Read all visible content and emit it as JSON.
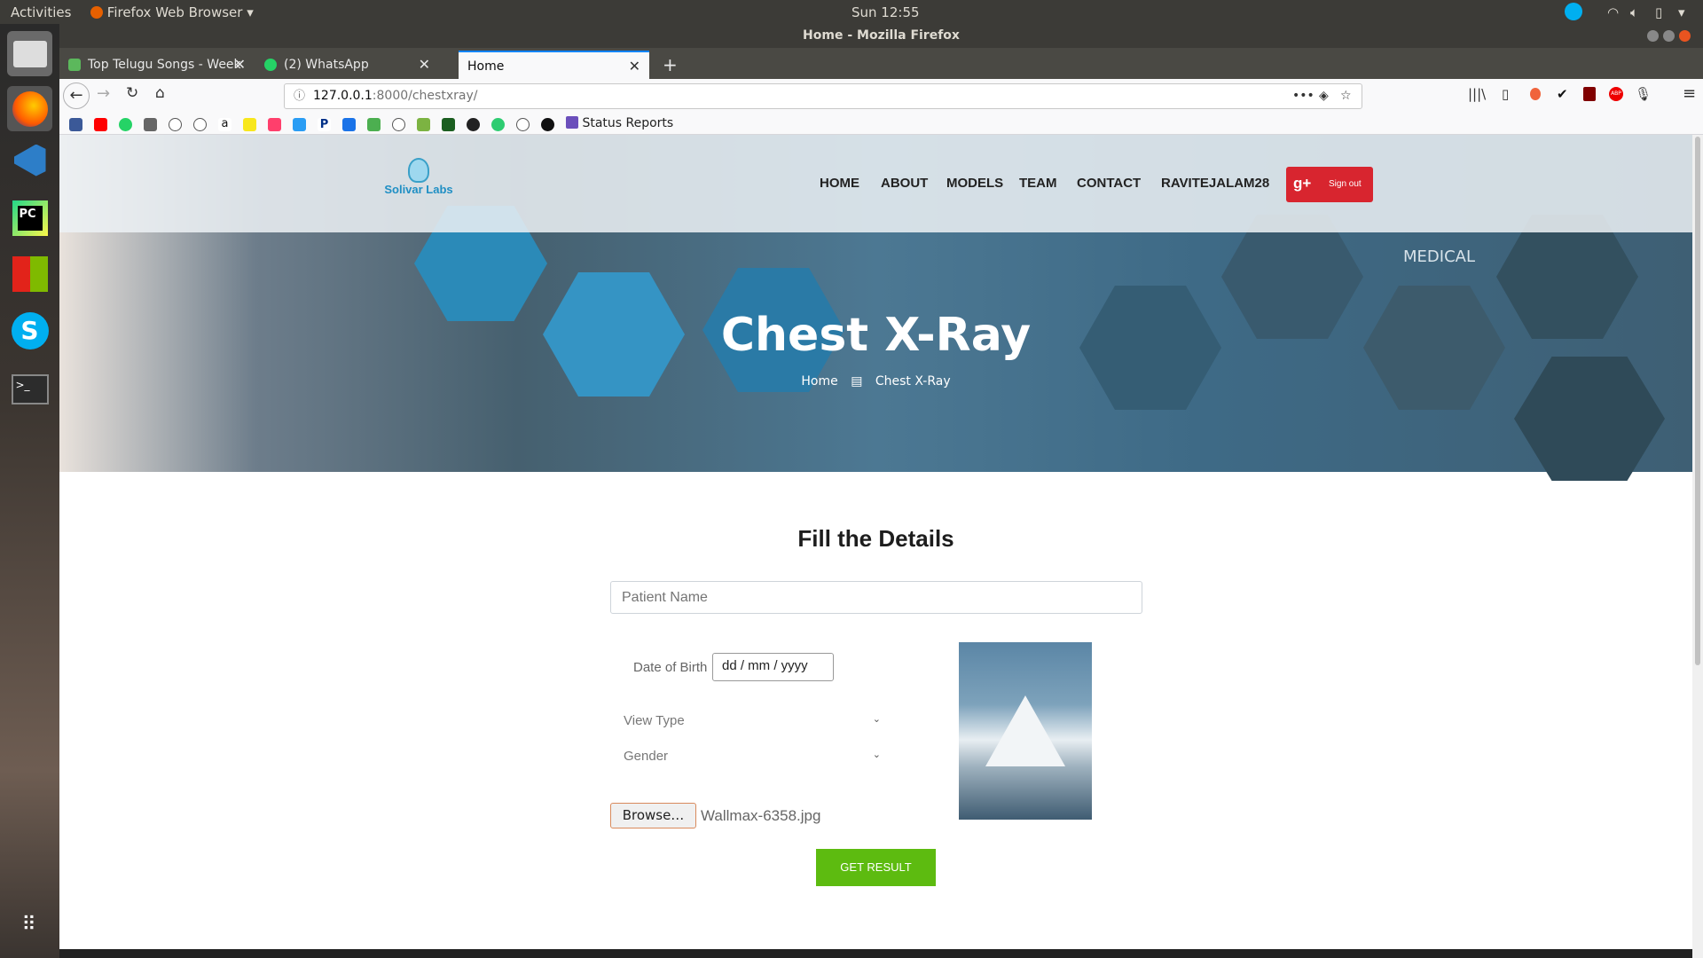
{
  "system": {
    "activities": "Activities",
    "app_menu": "Firefox Web Browser",
    "clock": "Sun 12:55"
  },
  "window": {
    "title": "Home - Mozilla Firefox"
  },
  "tabs": [
    {
      "label": "Top Telugu Songs - Week"
    },
    {
      "label": "(2) WhatsApp"
    },
    {
      "label": "Home"
    }
  ],
  "urlbar": {
    "host": "127.0.0.1",
    "rest": ":8000/chestxray/"
  },
  "bookmarks": {
    "status_reports": "Status Reports"
  },
  "site": {
    "brand": "Solivar Labs",
    "nav": [
      "HOME",
      "ABOUT",
      "MODELS",
      "TEAM",
      "CONTACT",
      "RAVITEJALAM28"
    ],
    "signout": "Sign out",
    "hero_title": "Chest X-Ray",
    "breadcrumb_home": "Home",
    "breadcrumb_current": "Chest X-Ray",
    "hero_texts": {
      "medical": "MEDICAL"
    }
  },
  "form": {
    "title": "Fill the Details",
    "patient_name_placeholder": "Patient Name",
    "dob_label": "Date of Birth",
    "dob_placeholder": "dd / mm / yyyy",
    "view_type": "View Type",
    "gender": "Gender",
    "browse_label": "Browse…",
    "file_name": "Wallmax-6358.jpg",
    "submit": "GET RESULT"
  },
  "colors": {
    "accent_green": "#5dbb10",
    "signout_red": "#d8252f",
    "hero_blue": "#2b8ab8"
  }
}
